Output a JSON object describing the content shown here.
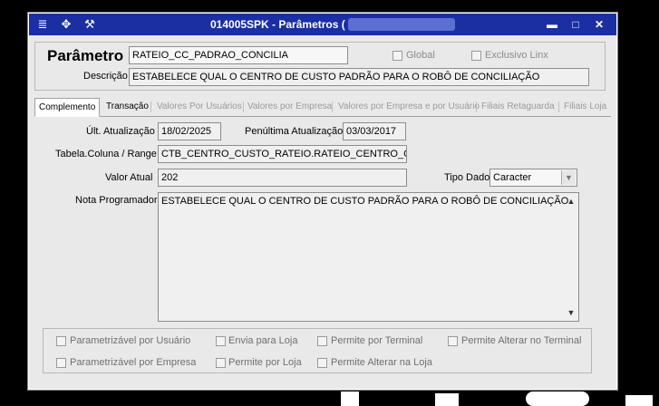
{
  "window": {
    "title": "014005SPK - Parâmetros (",
    "buttons": {
      "minimize": "▬",
      "maximize": "□",
      "close": "✕"
    }
  },
  "header": {
    "parametro_label": "Parâmetro",
    "parametro_value": "RATEIO_CC_PADRAO_CONCILIA",
    "global_label": "Global",
    "exclusivo_label": "Exclusivo Linx",
    "descricao_label": "Descrição",
    "descricao_value": "ESTABELECE QUAL O CENTRO DE CUSTO PADRÃO PARA O ROBÔ DE CONCILIAÇÃO"
  },
  "tabs": [
    {
      "label": "Complemento"
    },
    {
      "label": "Transação"
    },
    {
      "label": "Valores Por Usuários"
    },
    {
      "label": "Valores por Empresa"
    },
    {
      "label": "Valores por Empresa e por Usuário"
    },
    {
      "label": "Filiais Retaguarda"
    },
    {
      "label": "Filiais Loja"
    }
  ],
  "form": {
    "ult_atualizacao_label": "Últ. Atualização",
    "ult_atualizacao_value": "18/02/2025",
    "penultima_label": "Penúltima Atualização",
    "penultima_value": "03/03/2017",
    "tabela_label": "Tabela.Coluna / Range",
    "tabela_value": "CTB_CENTRO_CUSTO_RATEIO.RATEIO_CENTRO_CUST",
    "valor_atual_label": "Valor Atual",
    "valor_atual_value": "202",
    "tipo_dado_label": "Tipo Dado",
    "tipo_dado_value": "Caracter",
    "nota_label": "Nota Programador",
    "nota_value": "ESTABELECE QUAL O CENTRO DE CUSTO PADRÃO PARA O ROBÔ DE CONCILIAÇÃO"
  },
  "options": {
    "parametrizavel_usuario": "Parametrizável por Usuário",
    "envia_loja": "Envia para Loja",
    "permite_terminal": "Permite por Terminal",
    "permite_alterar_terminal": "Permite Alterar no Terminal",
    "parametrizavel_empresa": "Parametrizável por Empresa",
    "permite_loja": "Permite por Loja",
    "permite_alterar_loja": "Permite Alterar na Loja"
  },
  "icons": {
    "menu": "menu-icon",
    "tools": "tools-icon",
    "settings": "wrench-icon"
  },
  "colors": {
    "titlebar": "#1b2fa3",
    "window": "#e9e9e9",
    "field": "#f0f0f0"
  }
}
